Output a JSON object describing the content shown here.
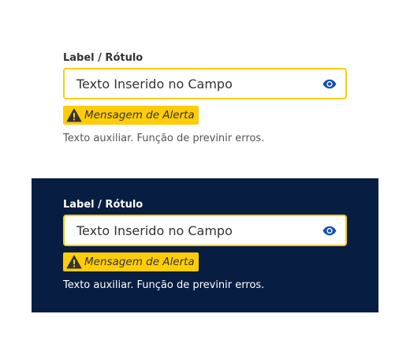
{
  "fields": [
    {
      "theme": "light",
      "label": "Label / Rótulo",
      "value": "Texto Inserido no Campo",
      "alert": "Mensagem de Alerta",
      "helper": "Texto auxiliar. Função de previnir erros.",
      "icons": {
        "toggle": "eye-icon",
        "alert": "warning-icon"
      }
    },
    {
      "theme": "dark",
      "label": "Label / Rótulo",
      "value": "Texto Inserido no Campo",
      "alert": "Mensagem de Alerta",
      "helper": "Texto auxiliar. Função de previnir erros.",
      "icons": {
        "toggle": "eye-icon",
        "alert": "warning-icon"
      }
    }
  ],
  "colors": {
    "warning": "#ffcd07",
    "dark_background": "#071d41",
    "eye_icon": "#1351b4",
    "text": "#333333"
  }
}
